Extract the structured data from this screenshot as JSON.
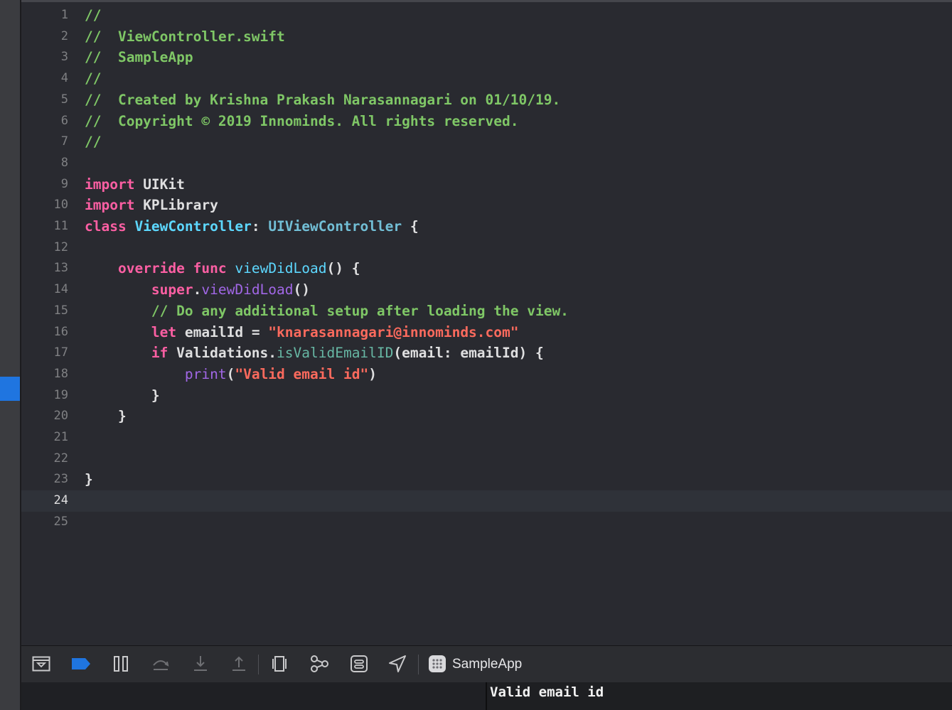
{
  "editor": {
    "current_line": "24",
    "lines": [
      {
        "n": "1",
        "tokens": [
          {
            "t": "//",
            "c": "comment"
          }
        ]
      },
      {
        "n": "2",
        "tokens": [
          {
            "t": "//  ViewController.swift",
            "c": "comment"
          }
        ]
      },
      {
        "n": "3",
        "tokens": [
          {
            "t": "//  SampleApp",
            "c": "comment"
          }
        ]
      },
      {
        "n": "4",
        "tokens": [
          {
            "t": "//",
            "c": "comment"
          }
        ]
      },
      {
        "n": "5",
        "tokens": [
          {
            "t": "//  Created by Krishna Prakash Narasannagari on 01/10/19.",
            "c": "comment"
          }
        ]
      },
      {
        "n": "6",
        "tokens": [
          {
            "t": "//  Copyright © 2019 Innominds. All rights reserved.",
            "c": "comment"
          }
        ]
      },
      {
        "n": "7",
        "tokens": [
          {
            "t": "//",
            "c": "comment"
          }
        ]
      },
      {
        "n": "8",
        "tokens": []
      },
      {
        "n": "9",
        "tokens": [
          {
            "t": "import",
            "c": "kw"
          },
          {
            "t": " UIKit",
            "c": "plain"
          }
        ]
      },
      {
        "n": "10",
        "tokens": [
          {
            "t": "import",
            "c": "kw"
          },
          {
            "t": " KPLibrary",
            "c": "plain"
          }
        ]
      },
      {
        "n": "11",
        "tokens": [
          {
            "t": "class",
            "c": "kw"
          },
          {
            "t": " ",
            "c": "plain"
          },
          {
            "t": "ViewController",
            "c": "type"
          },
          {
            "t": ": ",
            "c": "plain"
          },
          {
            "t": "UIViewController",
            "c": "typeb"
          },
          {
            "t": " {",
            "c": "plain"
          }
        ]
      },
      {
        "n": "12",
        "tokens": []
      },
      {
        "n": "13",
        "tokens": [
          {
            "t": "    ",
            "c": "plain"
          },
          {
            "t": "override",
            "c": "kw"
          },
          {
            "t": " ",
            "c": "plain"
          },
          {
            "t": "func",
            "c": "kw"
          },
          {
            "t": " ",
            "c": "plain"
          },
          {
            "t": "viewDidLoad",
            "c": "func"
          },
          {
            "t": "() {",
            "c": "plain"
          }
        ]
      },
      {
        "n": "14",
        "tokens": [
          {
            "t": "        ",
            "c": "plain"
          },
          {
            "t": "super",
            "c": "kw"
          },
          {
            "t": ".",
            "c": "plain"
          },
          {
            "t": "viewDidLoad",
            "c": "builtin"
          },
          {
            "t": "()",
            "c": "plain"
          }
        ]
      },
      {
        "n": "15",
        "tokens": [
          {
            "t": "        // Do any additional setup after loading the view.",
            "c": "comment"
          }
        ]
      },
      {
        "n": "16",
        "tokens": [
          {
            "t": "        ",
            "c": "plain"
          },
          {
            "t": "let",
            "c": "kw"
          },
          {
            "t": " emailId = ",
            "c": "plain"
          },
          {
            "t": "\"knarasannagari@innominds.com\"",
            "c": "string"
          }
        ]
      },
      {
        "n": "17",
        "tokens": [
          {
            "t": "        ",
            "c": "plain"
          },
          {
            "t": "if",
            "c": "kw"
          },
          {
            "t": " Validations.",
            "c": "plain"
          },
          {
            "t": "isValidEmailID",
            "c": "method"
          },
          {
            "t": "(email: emailId) {",
            "c": "plain"
          }
        ]
      },
      {
        "n": "18",
        "tokens": [
          {
            "t": "            ",
            "c": "plain"
          },
          {
            "t": "print",
            "c": "builtin"
          },
          {
            "t": "(",
            "c": "plain"
          },
          {
            "t": "\"Valid email id\"",
            "c": "string"
          },
          {
            "t": ")",
            "c": "plain"
          }
        ]
      },
      {
        "n": "19",
        "tokens": [
          {
            "t": "        }",
            "c": "plain"
          }
        ]
      },
      {
        "n": "20",
        "tokens": [
          {
            "t": "    }",
            "c": "plain"
          }
        ]
      },
      {
        "n": "21",
        "tokens": []
      },
      {
        "n": "22",
        "tokens": []
      },
      {
        "n": "23",
        "tokens": [
          {
            "t": "}",
            "c": "plain"
          }
        ]
      },
      {
        "n": "24",
        "tokens": []
      },
      {
        "n": "25",
        "tokens": []
      }
    ]
  },
  "debug_bar": {
    "buttons": [
      {
        "name": "hide-debug-area-button",
        "icon": "debug-area-toggle-icon",
        "disabled": false
      },
      {
        "name": "breakpoints-toggle-button",
        "icon": "breakpoint-icon",
        "disabled": false
      },
      {
        "name": "pause-button",
        "icon": "pause-icon",
        "disabled": false
      },
      {
        "name": "step-over-button",
        "icon": "step-over-icon",
        "disabled": true
      },
      {
        "name": "step-into-button",
        "icon": "step-into-icon",
        "disabled": true
      },
      {
        "name": "step-out-button",
        "icon": "step-out-icon",
        "disabled": true
      },
      {
        "name": "view-hierarchy-button",
        "icon": "view-hierarchy-icon",
        "disabled": false
      },
      {
        "name": "memory-graph-button",
        "icon": "memory-graph-icon",
        "disabled": false
      },
      {
        "name": "environment-overrides-button",
        "icon": "environment-overrides-icon",
        "disabled": false
      },
      {
        "name": "simulate-location-button",
        "icon": "location-arrow-icon",
        "disabled": false
      }
    ],
    "scheme_label": "SampleApp"
  },
  "console": {
    "output": "Valid email id"
  },
  "colors": {
    "editor_background": "#292a30",
    "comment": "#7fc766",
    "keyword": "#fc5fa3",
    "type": "#5dd8ff",
    "string": "#fc6a5d",
    "breakpoints_active": "#1f75e0"
  }
}
